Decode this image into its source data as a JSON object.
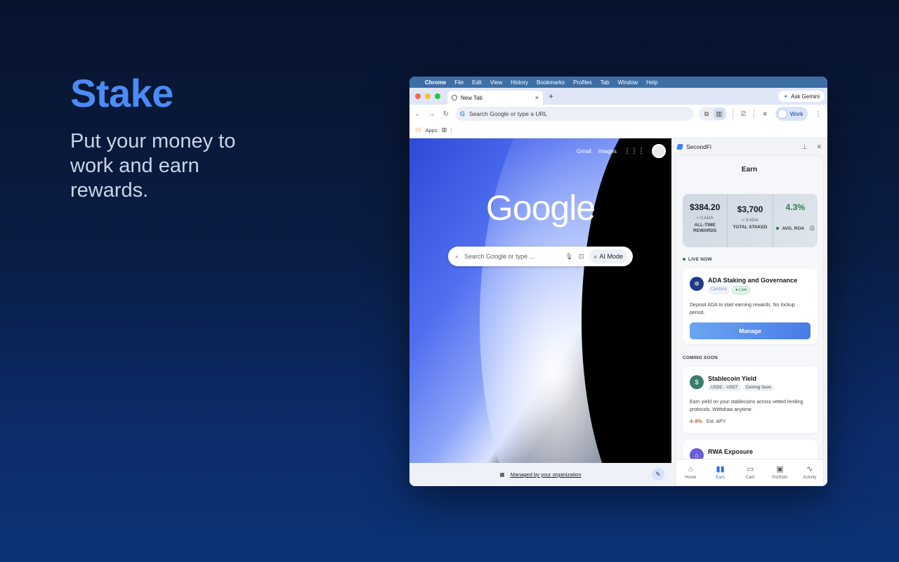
{
  "hero": {
    "title": "Stake",
    "subtitle": "Put your money to work and earn rewards."
  },
  "menubar": {
    "app": "Chrome",
    "items": [
      "File",
      "Edit",
      "View",
      "History",
      "Bookmarks",
      "Profiles",
      "Tab",
      "Window",
      "Help"
    ]
  },
  "tabs": {
    "active_label": "New Tab",
    "close_glyph": "×",
    "new_tab_glyph": "+",
    "ask_gemini": "Ask Gemini"
  },
  "toolbar": {
    "omnibox_placeholder": "Search Google or type a URL",
    "profile_label": "Work"
  },
  "bookmarks": {
    "apps_label": "Apps"
  },
  "ntp": {
    "gmail": "Gmail",
    "images": "Images",
    "logo": "Google",
    "search_placeholder": "Search Google or type ...",
    "ai_mode": "AI Mode",
    "managed": "Managed by your organization"
  },
  "sidepanel": {
    "name": "SecondFi",
    "page_title": "Earn",
    "stats": [
      {
        "value": "$384.20",
        "sub": "≈ 0 ADA",
        "label": "ALL-TIME REWARDS"
      },
      {
        "value": "$3,700",
        "sub": "≈ 3 ADA",
        "label": "TOTAL STAKED"
      },
      {
        "value": "4.3%",
        "sub": "",
        "label": "AVG. ROA"
      }
    ],
    "live_now": "LIVE NOW",
    "coming_soon": "COMING SOON",
    "cards": [
      {
        "title": "ADA Staking and Governance",
        "badge1": "Cardano",
        "badge2": "● Live",
        "desc": "Deposit ADA to start earning rewards. No lockup period.",
        "button": "Manage"
      },
      {
        "title": "Stablecoin Yield",
        "badge1": "USDC · USDT",
        "badge2": "Coming Soon",
        "desc": "Earn yield on your stablecoins across vetted lending protocols. Withdraw anytime.",
        "apy_range": "4–8%",
        "apy_label": "Est. APY"
      },
      {
        "title": "RWA Exposure"
      }
    ],
    "nav": [
      {
        "label": "Home",
        "icon": "home-icon"
      },
      {
        "label": "Earn",
        "icon": "bar-chart-icon"
      },
      {
        "label": "Card",
        "icon": "card-icon"
      },
      {
        "label": "Portfolio",
        "icon": "briefcase-icon"
      },
      {
        "label": "Activity",
        "icon": "pulse-icon"
      }
    ]
  },
  "colors": {
    "accent": "#4b8bf5",
    "live_green": "#2f7d4f",
    "apy_orange": "#c0622a",
    "nav_active": "#2f6ee8"
  }
}
